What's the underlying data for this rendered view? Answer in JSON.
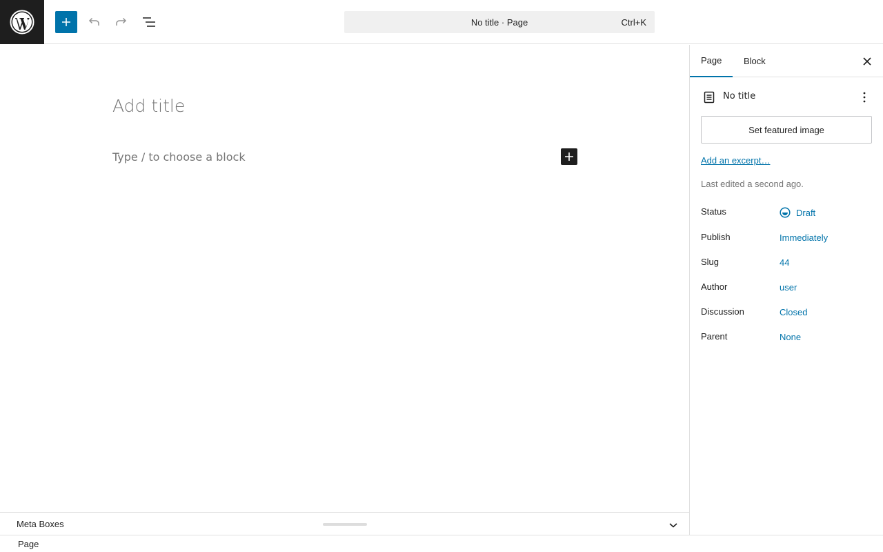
{
  "header": {
    "command_title": "No title · Page",
    "command_shortcut": "Ctrl+K",
    "icons": {
      "logo": "wordpress-logo",
      "add": "plus-icon",
      "undo": "undo-icon",
      "redo": "redo-icon",
      "list": "document-overview-icon"
    },
    "accent_color": "#0073aa"
  },
  "editor": {
    "title_placeholder": "Add title",
    "block_placeholder": "Type / to choose a block"
  },
  "metabox": {
    "label": "Meta Boxes"
  },
  "footer": {
    "breadcrumb": "Page"
  },
  "sidebar": {
    "tabs": [
      {
        "label": "Page",
        "active": true
      },
      {
        "label": "Block",
        "active": false
      }
    ],
    "document_title": "No title",
    "featured_image_label": "Set featured image",
    "excerpt_link": "Add an excerpt…",
    "last_edited": "Last edited a second ago.",
    "properties": [
      {
        "key": "Status",
        "value": "Draft"
      },
      {
        "key": "Publish",
        "value": "Immediately"
      },
      {
        "key": "Slug",
        "value": "44"
      },
      {
        "key": "Author",
        "value": "user"
      },
      {
        "key": "Discussion",
        "value": "Closed"
      },
      {
        "key": "Parent",
        "value": "None"
      }
    ]
  }
}
